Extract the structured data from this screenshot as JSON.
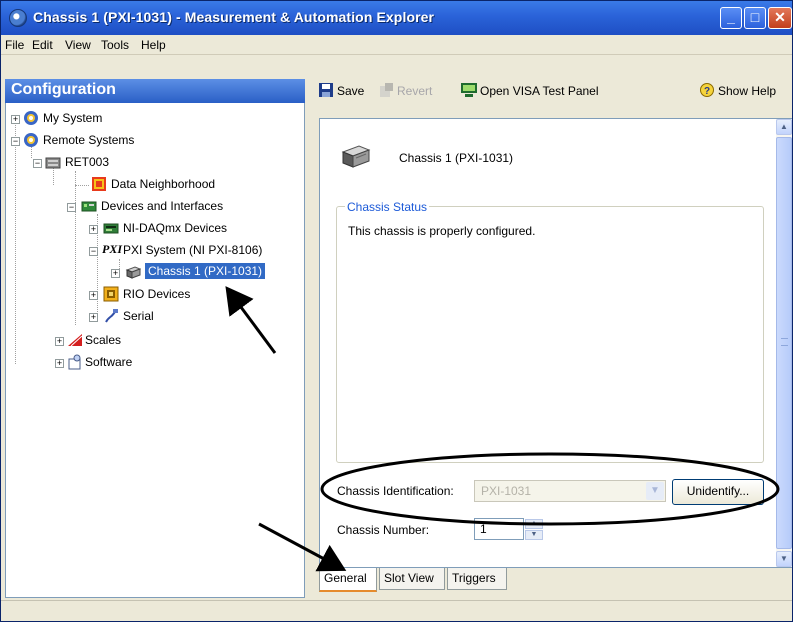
{
  "window": {
    "title": "Chassis 1 (PXI-1031) - Measurement & Automation Explorer",
    "minimize_label": "_",
    "maximize_label": "□",
    "close_label": "✕"
  },
  "menu": [
    "File",
    "Edit",
    "View",
    "Tools",
    "Help"
  ],
  "left_panel": {
    "header": "Configuration",
    "tree": [
      {
        "label": "My System",
        "expander": "+",
        "icon": "my-system-icon"
      },
      {
        "label": "Remote Systems",
        "expander": "−",
        "icon": "remote-systems-icon"
      },
      {
        "label": "RET003",
        "expander": "−",
        "icon": "computer-icon"
      },
      {
        "label": "Data Neighborhood",
        "expander": "",
        "icon": "data-neighborhood-icon"
      },
      {
        "label": "Devices and Interfaces",
        "expander": "−",
        "icon": "devices-interfaces-icon"
      },
      {
        "label": "NI-DAQmx Devices",
        "expander": "+",
        "icon": "daqmx-icon"
      },
      {
        "label": "PXI System (NI PXI-8106)",
        "expander": "−",
        "icon": "pxi-icon",
        "icon_text": "PXI"
      },
      {
        "label": "Chassis 1 (PXI-1031)",
        "expander": "+",
        "icon": "chassis-icon",
        "selected": true
      },
      {
        "label": "RIO Devices",
        "expander": "+",
        "icon": "rio-icon"
      },
      {
        "label": "Serial",
        "expander": "+",
        "icon": "serial-icon"
      },
      {
        "label": "Scales",
        "expander": "+",
        "icon": "scales-icon"
      },
      {
        "label": "Software",
        "expander": "+",
        "icon": "software-icon"
      }
    ]
  },
  "toolbar": {
    "save": "Save",
    "revert": "Revert",
    "visa": "Open VISA Test Panel",
    "help": "Show Help"
  },
  "content": {
    "chassis_name": "Chassis 1 (PXI-1031)",
    "status_legend": "Chassis Status",
    "status_text": "This chassis is properly configured.",
    "identification_label": "Chassis Identification:",
    "identification_value": "PXI-1031",
    "unidentify_button": "Unidentify...",
    "number_label": "Chassis Number:",
    "number_value": "1"
  },
  "tabs": [
    "General",
    "Slot View",
    "Triggers"
  ],
  "active_tab": "General",
  "colors": {
    "title_bar": "#2a62d8",
    "selection": "#316ac5",
    "group_legend": "#1c5ad8",
    "annotation": "#000000"
  }
}
